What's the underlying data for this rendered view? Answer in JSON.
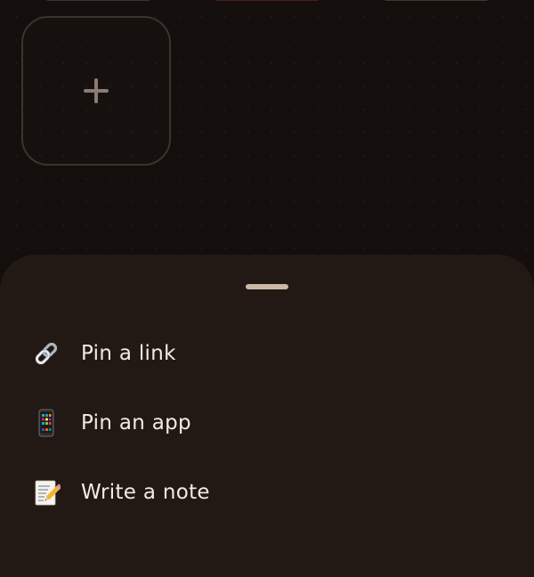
{
  "colors": {
    "background": "#140f0c",
    "sheet": "#221915",
    "tile_border": "#3b332d",
    "plus": "#8a7c72",
    "grabber": "#c9b9a6",
    "text": "#f3ebe2"
  },
  "add_tile": {
    "icon": "plus-icon"
  },
  "sheet": {
    "items": [
      {
        "label": "Pin a link",
        "icon": "link-icon"
      },
      {
        "label": "Pin an app",
        "icon": "phone-icon"
      },
      {
        "label": "Write a note",
        "icon": "memo-icon"
      }
    ]
  }
}
